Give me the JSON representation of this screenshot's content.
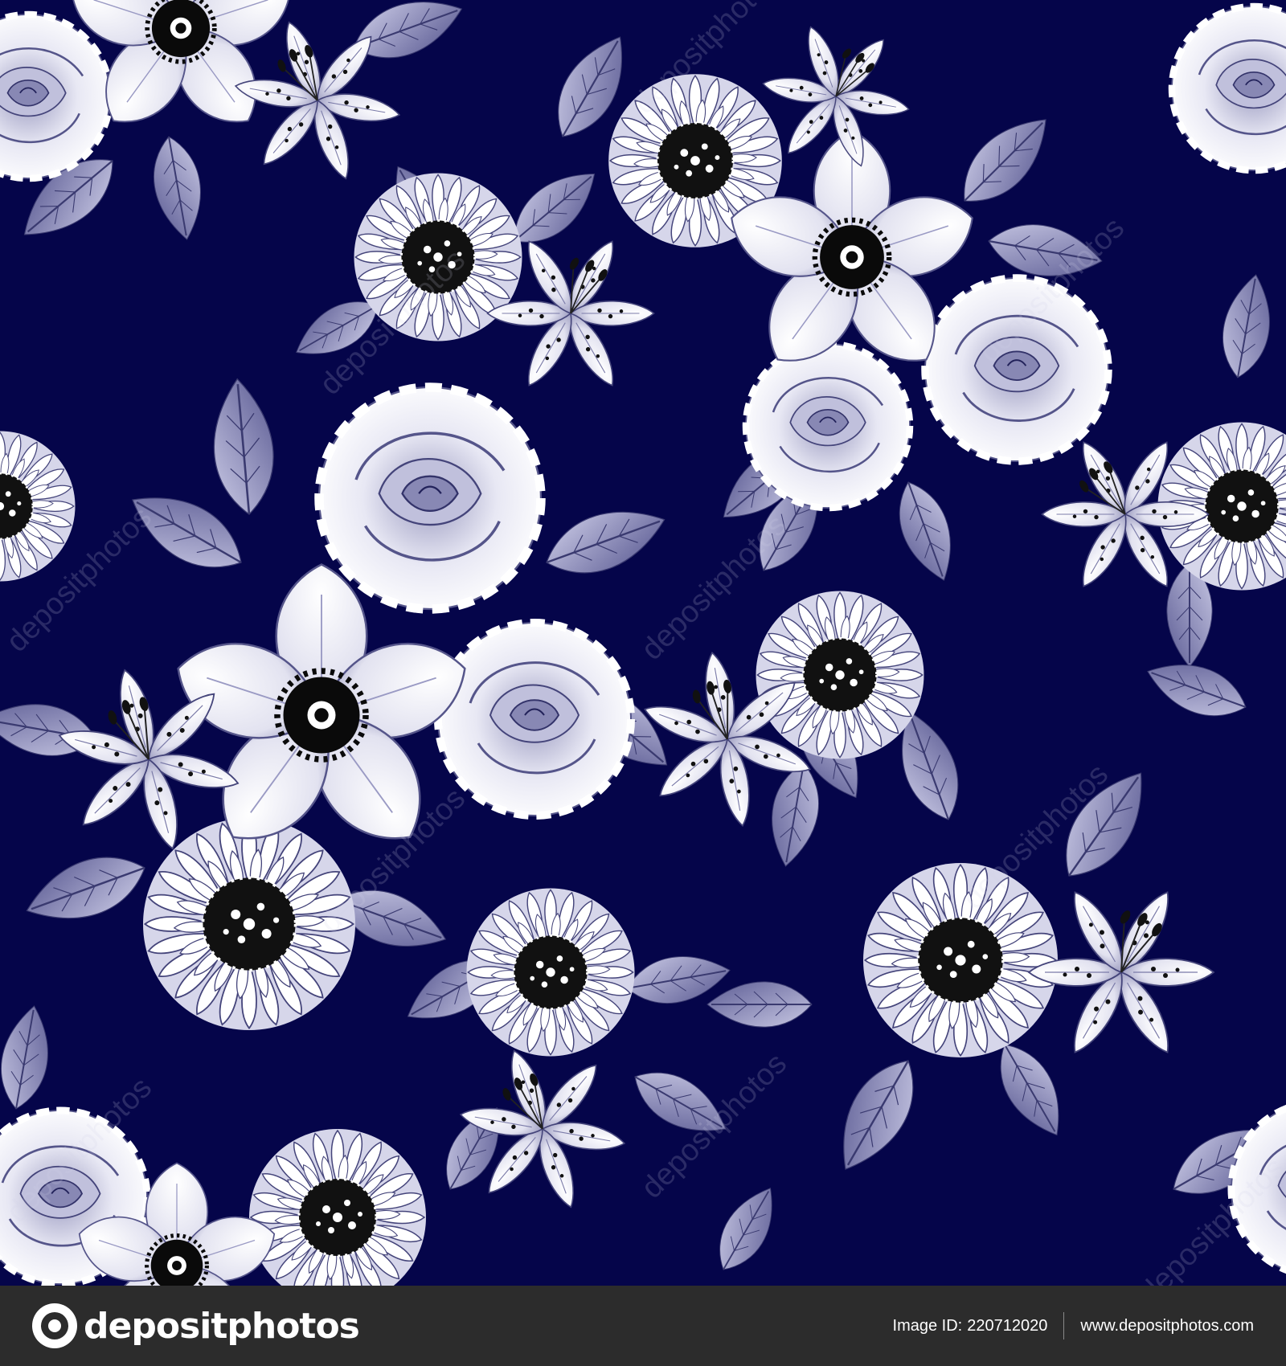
{
  "watermark": {
    "text": "depositphotos"
  },
  "footer": {
    "logo_text": "depositphotos",
    "image_id_label": "Image ID:",
    "image_id": "220712020",
    "site_url": "www.depositphotos.com"
  },
  "colors": {
    "background": "#05054a",
    "petal": "#ffffff",
    "petal_shade": "#8c8cb4",
    "leaf": "#9a9ac4",
    "flower_center": "#000000",
    "footer_bg": "#2c2c2c"
  }
}
